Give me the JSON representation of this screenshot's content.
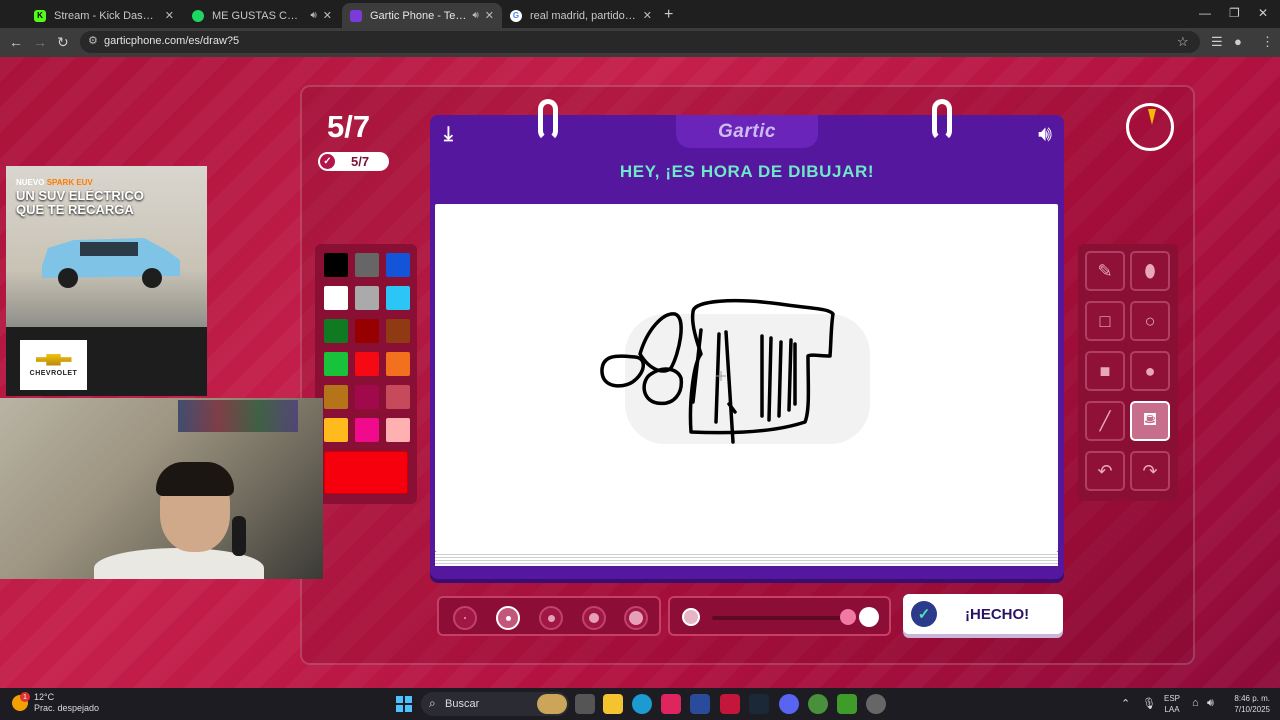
{
  "browser": {
    "tabs": [
      {
        "title": "Stream - Kick Dashboard",
        "favicon_color": "#53fc18",
        "favicon_letter": "K",
        "active": false
      },
      {
        "title": "ME GUSTAS CC • ROA",
        "favicon_color": "#1ed760",
        "favicon_letter": "",
        "active": false,
        "audio": true
      },
      {
        "title": "Gartic Phone - Teléfono De",
        "favicon_color": "#7c3ad8",
        "favicon_letter": "",
        "active": true,
        "audio": true
      },
      {
        "title": "real madrid, partidos - Buscar c",
        "favicon_color": "#ffffff",
        "favicon_letter": "G",
        "active": false
      }
    ],
    "new_tab": "+",
    "url": "garticphone.com/es/draw?5"
  },
  "game": {
    "round": "5/7",
    "players_done": "5/7",
    "logo": "Gartic",
    "heading": "HEY, ¡ES HORA DE DIBUJAR!",
    "done_button": "¡HECHO!",
    "timer_remaining_fraction": 0.96,
    "palette": [
      "#000000",
      "#666666",
      "#1454d8",
      "#ffffff",
      "#aaaaaa",
      "#2bc6f5",
      "#0f7a22",
      "#970000",
      "#8f3a12",
      "#18c23a",
      "#f50a14",
      "#f2701e",
      "#b6741a",
      "#a00a4c",
      "#c64a5c",
      "#ffbb1e",
      "#f00a8c",
      "#ffb0b0"
    ],
    "selected_color": "#f5000c",
    "brush_sizes_selected_index": 1,
    "opacity_value": 1.0,
    "tools": [
      "pencil",
      "eraser",
      "rectangle-outline",
      "ellipse-outline",
      "rectangle-filled",
      "ellipse-filled",
      "line",
      "fill-bucket",
      "undo",
      "redo"
    ],
    "selected_tool": "fill-bucket"
  },
  "stream_overlay": {
    "ad_tag_nuevo": "NUEVO",
    "ad_tag_model": "SPARK EUV",
    "ad_headline": "UN SUV ELÉCTRICO QUE TE RECARGA",
    "ad_brand": "CHEVROLET"
  },
  "taskbar": {
    "weather_temp": "12°C",
    "weather_desc": "Prac. despejado",
    "weather_badge": "1",
    "search_placeholder": "Buscar",
    "lang_line1": "ESP",
    "lang_line2": "LAA",
    "time": "8:46 p. m.",
    "date": "7/10/2025"
  }
}
